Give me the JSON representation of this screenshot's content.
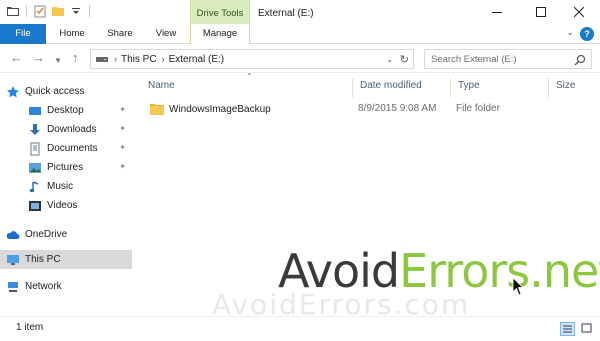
{
  "window": {
    "title": "External (E:)",
    "context_tab_group": "Drive Tools"
  },
  "ribbon": {
    "tabs": [
      "File",
      "Home",
      "Share",
      "View",
      "Manage"
    ],
    "help_label": "?"
  },
  "address_bar": {
    "crumbs": [
      "This PC",
      "External (E:)"
    ],
    "separator": "›"
  },
  "search": {
    "placeholder": "Search External (E:)"
  },
  "nav_pane": {
    "items": [
      {
        "label": "Quick access",
        "icon": "star-icon"
      },
      {
        "label": "Desktop",
        "icon": "desktop-icon",
        "pinned": true
      },
      {
        "label": "Downloads",
        "icon": "download-icon",
        "pinned": true
      },
      {
        "label": "Documents",
        "icon": "documents-icon",
        "pinned": true
      },
      {
        "label": "Pictures",
        "icon": "pictures-icon",
        "pinned": true
      },
      {
        "label": "Music",
        "icon": "music-icon"
      },
      {
        "label": "Videos",
        "icon": "videos-icon"
      },
      {
        "label": "OneDrive",
        "icon": "cloud-icon"
      },
      {
        "label": "This PC",
        "icon": "computer-icon",
        "selected": true
      },
      {
        "label": "Network",
        "icon": "network-icon"
      }
    ]
  },
  "file_list": {
    "columns": [
      "Name",
      "Date modified",
      "Type",
      "Size"
    ],
    "rows": [
      {
        "name": "WindowsImageBackup",
        "date_modified": "8/9/2015 9:08 AM",
        "type": "File folder",
        "size": ""
      }
    ]
  },
  "status_bar": {
    "item_count": "1 item"
  },
  "watermark": {
    "part1": "Avoid",
    "part2": "Errors.net",
    "reflection": "AvoidErrors.com"
  },
  "colors": {
    "file_tab": "#1979ca",
    "context_tab": "#d9ecbe",
    "folder": "#f5c852",
    "selection": "#d9d9d9",
    "watermark_green": "#8dc63f"
  }
}
